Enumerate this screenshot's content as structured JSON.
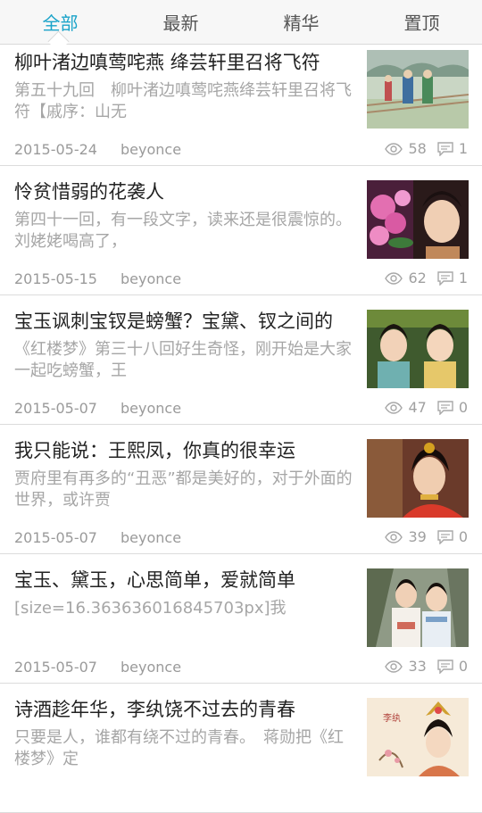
{
  "tabs": [
    {
      "label": "全部",
      "active": true
    },
    {
      "label": "最新",
      "active": false
    },
    {
      "label": "精华",
      "active": false
    },
    {
      "label": "置顶",
      "active": false
    }
  ],
  "accent_color": "#1aa3c9",
  "articles": [
    {
      "title": "柳叶渚边嗔莺咤燕 绛芸轩里召将飞符",
      "summary": "第五十九回　柳叶渚边嗔莺咤燕绛芸轩里召将飞符【戚序：山无",
      "date": "2015-05-24",
      "author": "beyonce",
      "views": "58",
      "comments": "1",
      "thumb_icon": "garden-painting"
    },
    {
      "title": "怜贫惜弱的花袭人",
      "summary": "第四十一回，有一段文字，读来还是很震惊的。刘姥姥喝高了，",
      "date": "2015-05-15",
      "author": "beyonce",
      "views": "62",
      "comments": "1",
      "thumb_icon": "flowers-portrait"
    },
    {
      "title": "宝玉讽刺宝钗是螃蟹？宝黛、钗之间的",
      "summary": "《红楼梦》第三十八回好生奇怪，刚开始是大家一起吃螃蟹，王",
      "date": "2015-05-07",
      "author": "beyonce",
      "views": "47",
      "comments": "0",
      "thumb_icon": "two-ladies"
    },
    {
      "title": "我只能说：王熙凤，你真的很幸运",
      "summary": "贾府里有再多的“丑恶”都是美好的，对于外面的世界，或许贾",
      "date": "2015-05-07",
      "author": "beyonce",
      "views": "39",
      "comments": "0",
      "thumb_icon": "portrait-red"
    },
    {
      "title": "宝玉、黛玉，心思简单，爱就简单",
      "summary": "[size=16.363636016845703px]我",
      "date": "2015-05-07",
      "author": "beyonce",
      "views": "33",
      "comments": "0",
      "thumb_icon": "couple-outdoor"
    },
    {
      "title": "诗酒趁年华，李纨饶不过去的青春",
      "summary": "只要是人，谁都有绕不过的青春。　蒋勋把《红楼梦》定",
      "date": "",
      "author": "",
      "views": "",
      "comments": "",
      "thumb_icon": "painted-lady"
    }
  ]
}
